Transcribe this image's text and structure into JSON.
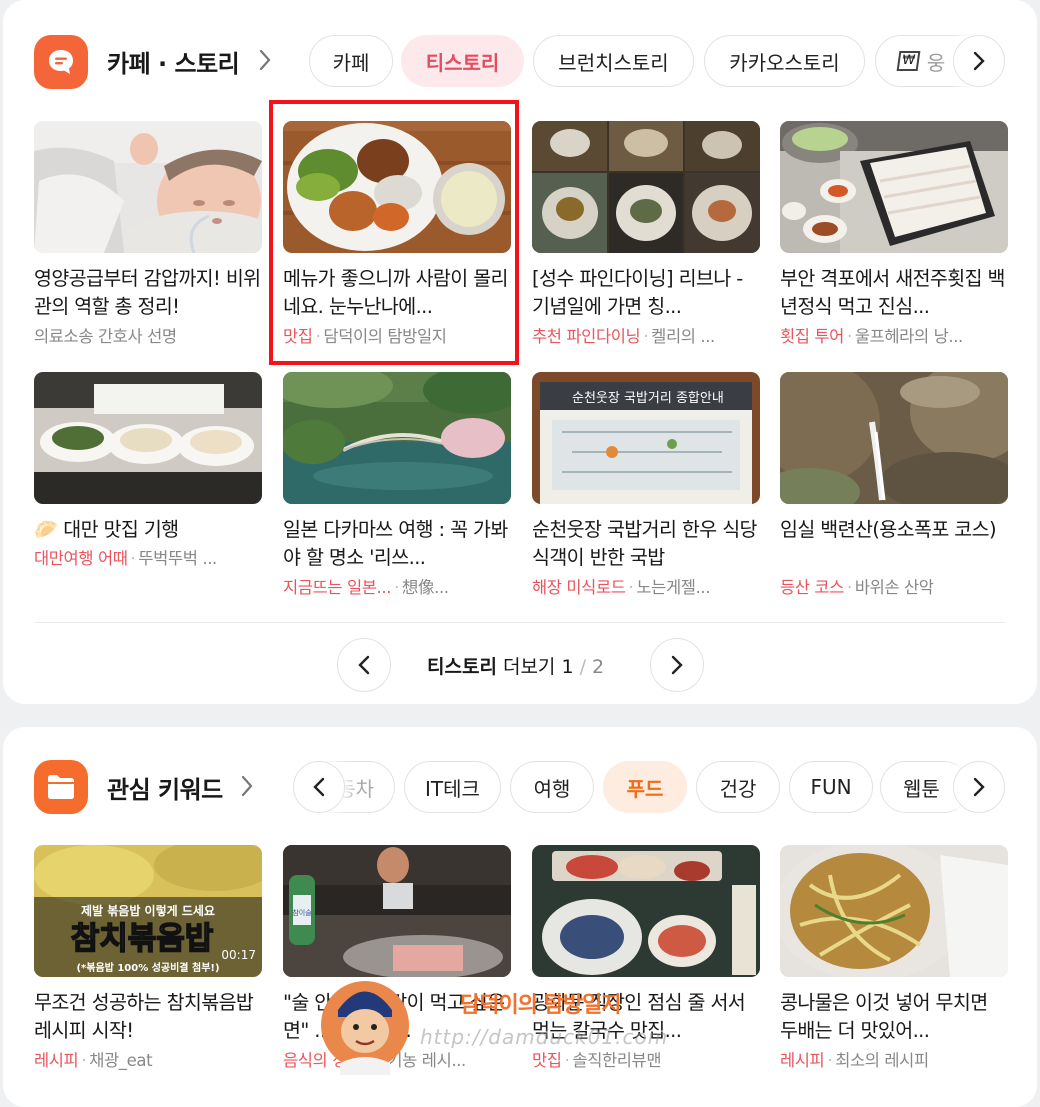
{
  "section1": {
    "title": "카페 · 스토리",
    "app_icon": "chat-bubble-icon",
    "tabs": [
      "카페",
      "티스토리",
      "브런치스토리",
      "카카오스토리",
      "웅"
    ],
    "active_tab": "티스토리",
    "posts": [
      {
        "title": "영양공급부터 감압까지! 비위관의 역할 총 정리!",
        "category": "",
        "source": "의료소송 간호사 선명"
      },
      {
        "title": "메뉴가 좋으니까 사람이 몰리네요. 눈누난나에...",
        "category": "맛집",
        "source": "담덕이의 탐방일지"
      },
      {
        "title": "[성수 파인다이닝] 리브나 - 기념일에 가면 칭...",
        "category": "추천 파인다이닝",
        "source": "켈리의 ..."
      },
      {
        "title": "부안 격포에서 새전주횟집 백년정식 먹고 진심...",
        "category": "횟집 투어",
        "source": "울프헤라의 낭..."
      },
      {
        "title": "🥟 대만 맛집 기행",
        "category": "대만여행 어때",
        "source": "뚜벅뚜벅 ..."
      },
      {
        "title": "일본 다카마쓰 여행 : 꼭 가봐야 할 명소 '리쓰...",
        "category": "지금뜨는 일본...",
        "source": "想像..."
      },
      {
        "title": "순천웃장 국밥거리 한우 식당 식객이 반한 국밥",
        "category": "해장 미식로드",
        "source": "노는게젤..."
      },
      {
        "title": "임실 백련산(용소폭포 코스)",
        "category": "등산 코스",
        "source": "바위손 산악"
      }
    ],
    "thumb_texts": {
      "sign": "순천웃장 국밥거리 종합안내"
    },
    "pager": {
      "label": "티스토리",
      "more": "더보기",
      "current": "1",
      "sep": "/",
      "total": "2"
    }
  },
  "section2": {
    "title": "관심 키워드",
    "app_icon": "folder-icon",
    "tabs": [
      "동차",
      "IT테크",
      "여행",
      "푸드",
      "건강",
      "FUN",
      "웹툰"
    ],
    "active_tab": "푸드",
    "posts": [
      {
        "title": "무조건 성공하는 참치볶음밥 레시피 시작!",
        "category": "레시피",
        "source": "채광_eat"
      },
      {
        "title": "\"술 안마셔도 같이 먹고 싶은 면\" ... 걸릴 수...",
        "category": "음식의 정석",
        "source": "유기농 레시..."
      },
      {
        "title": "광화문 직장인 점심 줄 서서 먹는 칼국수 맛집...",
        "category": "맛집",
        "source": "솔직한리뷰맨"
      },
      {
        "title": "콩나물은 이것 넣어 무치면 두배는 더 맛있어...",
        "category": "레시피",
        "source": "최소의 레시피"
      }
    ],
    "thumb_texts": {
      "line1": "제발 볶음밥 이렇게 드세요",
      "line2": "참치볶음밥",
      "line3": "(*볶음밥 100% 성공비결 첨부!)",
      "duration": "00:17",
      "soju": "참이슬"
    }
  },
  "watermark": {
    "text": "담덕이의 탐방일지",
    "url": "http://damduck01.com"
  },
  "colors": {
    "accent_red": "#e9555d",
    "active_chip_bg": "#fde9ec",
    "food_chip": "#f36a17",
    "highlight": "#f4121b",
    "app_icon_orange": "#f56c2c"
  }
}
